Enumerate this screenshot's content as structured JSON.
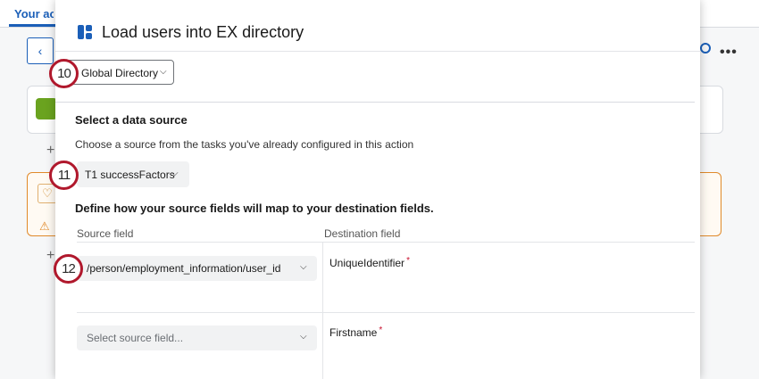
{
  "background": {
    "tab_label": "Your actions",
    "back_icon": "chevron-left-icon",
    "more_icon": "ellipsis-icon"
  },
  "modal": {
    "title": "Load users into EX directory",
    "logo_icon": "qualtrics-app-icon",
    "directory_select": {
      "value": "Global Directory"
    },
    "data_source": {
      "heading": "Select a data source",
      "description": "Choose a source from the tasks you've already configured in this action",
      "selected_task": "T1 successFactors"
    },
    "mapping": {
      "heading": "Define how your source fields will map to your destination fields.",
      "source_header": "Source field",
      "destination_header": "Destination field",
      "rows": [
        {
          "source_value": "/person/employment_information/user_id",
          "destination": "UniqueIdentifier",
          "required_mark": "*"
        },
        {
          "source_placeholder": "Select source field...",
          "destination": "Firstname",
          "required_mark": "*"
        }
      ]
    }
  },
  "callouts": {
    "directory": "10",
    "source": "11",
    "field": "12"
  },
  "colors": {
    "accent": "#1b5fb8",
    "callout": "#b0182c",
    "required": "#c8102e",
    "warning": "#e08a2a",
    "success": "#6aa31f"
  }
}
